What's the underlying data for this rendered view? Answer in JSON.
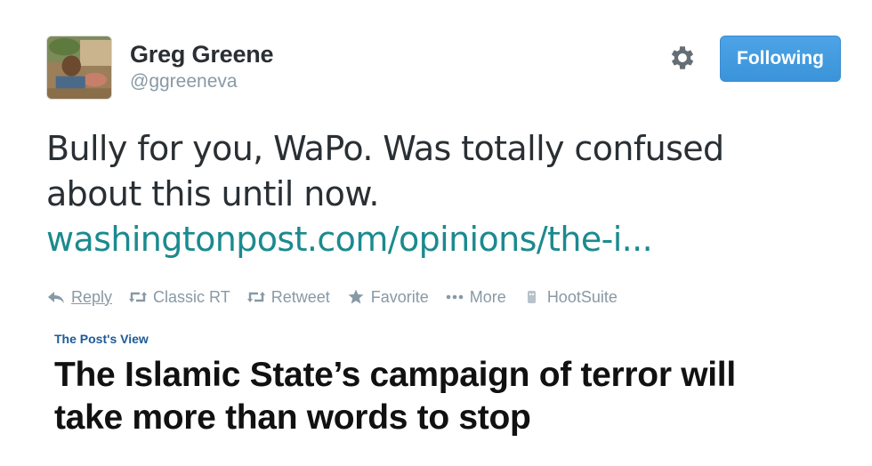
{
  "user": {
    "full_name": "Greg Greene",
    "handle": "@ggreeneva"
  },
  "follow_button": {
    "label": "Following"
  },
  "tweet": {
    "text_lines": [
      "Bully for you, WaPo. Was totally confused",
      "about this until now."
    ],
    "link": "washingtonpost.com/opinions/the-i..."
  },
  "actions": [
    {
      "label": "Reply",
      "icon": "reply-icon"
    },
    {
      "label": "Classic RT",
      "icon": "retweet-icon"
    },
    {
      "label": "Retweet",
      "icon": "retweet-icon"
    },
    {
      "label": "Favorite",
      "icon": "star-icon"
    },
    {
      "label": "More",
      "icon": "more-dots-icon"
    },
    {
      "label": "HootSuite",
      "icon": "hootsuite-icon"
    }
  ],
  "card": {
    "kicker": "The Post's View",
    "headline_lines": [
      "The Islamic State’s campaign of terror will",
      "take more than words to stop"
    ]
  },
  "colors": {
    "link": "#1b8a8f",
    "button": "#3b94d9",
    "muted": "#8899a6",
    "kicker": "#1c5a96"
  }
}
